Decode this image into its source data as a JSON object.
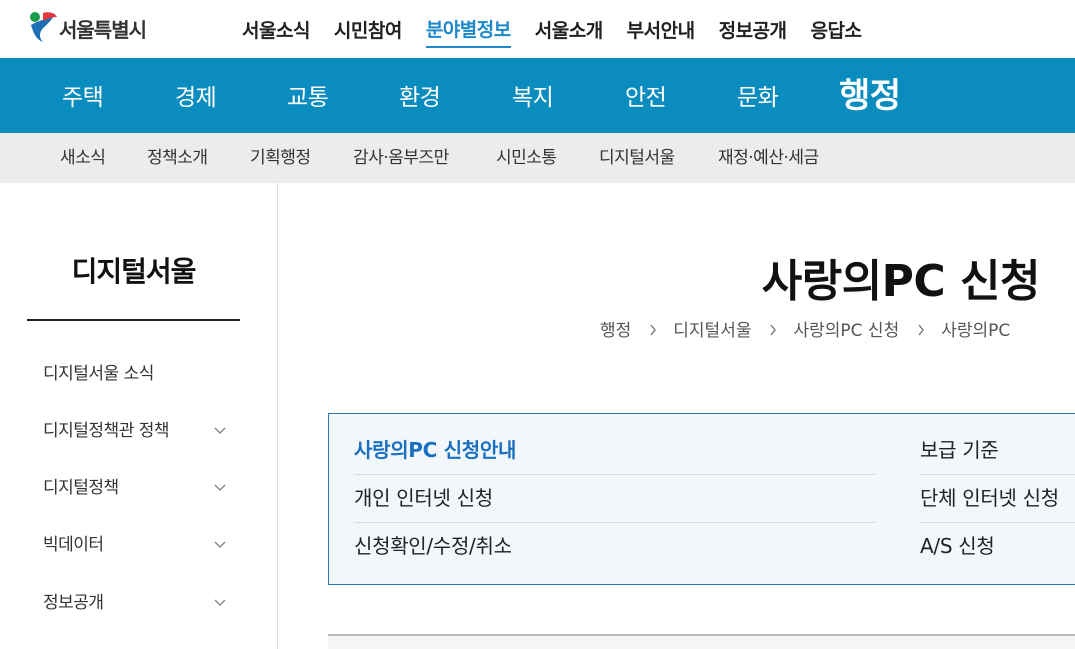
{
  "header": {
    "logo_text": "서울특별시",
    "nav": [
      {
        "label": "서울소식"
      },
      {
        "label": "시민참여"
      },
      {
        "label": "분야별정보"
      },
      {
        "label": "서울소개"
      },
      {
        "label": "부서안내"
      },
      {
        "label": "정보공개"
      },
      {
        "label": "응답소"
      }
    ],
    "active_nav": "분야별정보"
  },
  "categories": [
    {
      "label": "주택"
    },
    {
      "label": "경제"
    },
    {
      "label": "교통"
    },
    {
      "label": "환경"
    },
    {
      "label": "복지"
    },
    {
      "label": "안전"
    },
    {
      "label": "문화"
    },
    {
      "label": "행정"
    }
  ],
  "active_category": "행정",
  "subnav": [
    {
      "label": "새소식"
    },
    {
      "label": "정책소개"
    },
    {
      "label": "기획행정"
    },
    {
      "label": "감사·옴부즈만"
    },
    {
      "label": "시민소통"
    },
    {
      "label": "디지털서울"
    },
    {
      "label": "재정·예산·세금"
    }
  ],
  "sidebar": {
    "title": "디지털서울",
    "items": [
      {
        "label": "디지털서울 소식",
        "expandable": false
      },
      {
        "label": "디지털정책관 정책",
        "expandable": true
      },
      {
        "label": "디지털정책",
        "expandable": true
      },
      {
        "label": "빅데이터",
        "expandable": true
      },
      {
        "label": "정보공개",
        "expandable": true
      }
    ]
  },
  "main": {
    "title": "사랑의PC 신청",
    "breadcrumb": [
      "행정",
      "디지털서울",
      "사랑의PC 신청",
      "사랑의PC"
    ],
    "tabs": [
      {
        "label": "사랑의PC 신청안내",
        "active": true
      },
      {
        "label": "개인 인터넷 신청",
        "active": false
      },
      {
        "label": "신청확인/수정/취소",
        "active": false
      },
      {
        "label": "보급 기준",
        "active": false
      },
      {
        "label": "단체 인터넷 신청",
        "active": false
      },
      {
        "label": "A/S 신청",
        "active": false
      }
    ]
  },
  "colors": {
    "accent": "#0a8cbe",
    "active_link": "#1a70c0",
    "subnav_bg": "#ececec",
    "tab_box_bg": "#f2f7fc",
    "tab_box_border": "#2a78b8"
  }
}
